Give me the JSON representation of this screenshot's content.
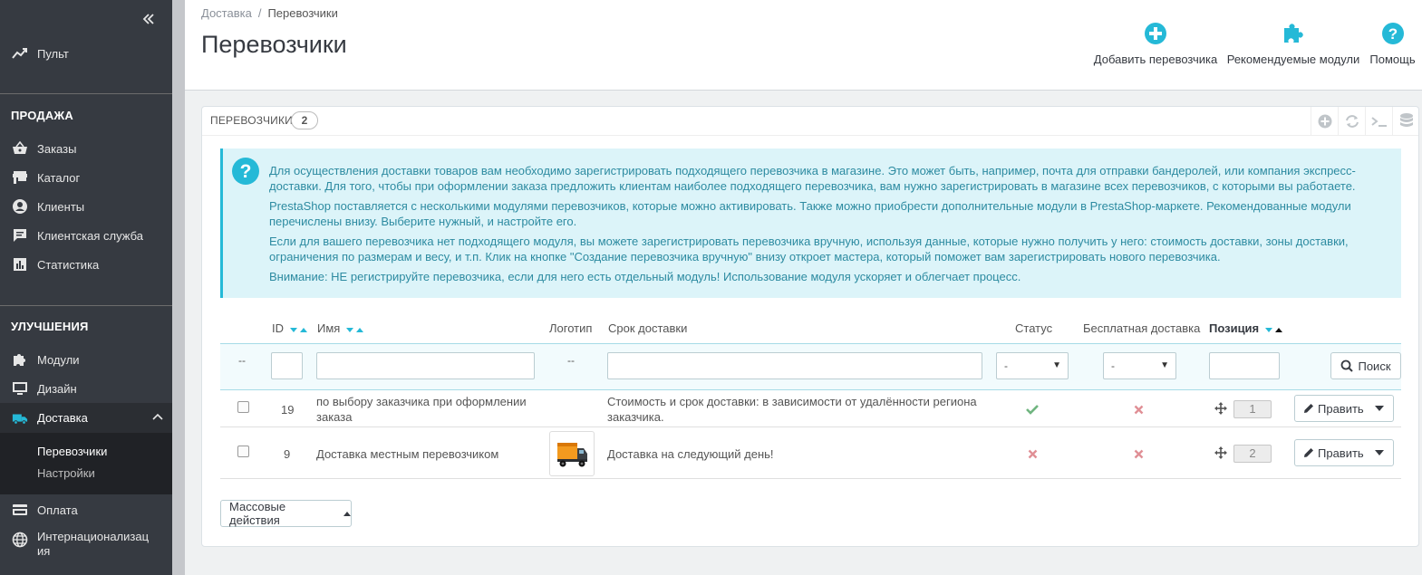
{
  "sidebar": {
    "items_top": [
      {
        "label": "Пульт",
        "icon": "trending-up-icon"
      }
    ],
    "section_sales": "ПРОДАЖА",
    "sales_items": [
      {
        "label": "Заказы",
        "icon": "basket-icon"
      },
      {
        "label": "Каталог",
        "icon": "store-icon"
      },
      {
        "label": "Клиенты",
        "icon": "account-icon"
      },
      {
        "label": "Клиентская служба",
        "icon": "chat-icon"
      },
      {
        "label": "Статистика",
        "icon": "bar-chart-icon"
      }
    ],
    "section_improve": "УЛУЧШЕНИЯ",
    "improve_items": [
      {
        "label": "Модули",
        "icon": "puzzle-icon"
      },
      {
        "label": "Дизайн",
        "icon": "monitor-icon"
      },
      {
        "label": "Доставка",
        "icon": "truck-icon",
        "active": true
      },
      {
        "label": "Оплата",
        "icon": "credit-card-icon"
      },
      {
        "label": "Интернационализация",
        "icon": "globe-icon"
      }
    ],
    "intl_line1": "Интернационализац",
    "intl_line2": "ия",
    "shipping_sub": [
      "Перевозчики",
      "Настройки"
    ]
  },
  "header": {
    "breadcrumb": [
      "Доставка",
      "Перевозчики"
    ],
    "title": "Перевозчики",
    "toolbar": [
      {
        "label": "Добавить перевозчика",
        "icon": "add-circle-icon"
      },
      {
        "label": "Рекомендуемые модули",
        "icon": "puzzle-icon"
      },
      {
        "label": "Помощь",
        "icon": "help-circle-icon"
      }
    ]
  },
  "panel": {
    "title": "Перевозчики",
    "count": "2",
    "info": [
      "Для осуществления доставки товаров вам необходимо зарегистрировать подходящего перевозчика в магазине. Это может быть, например, почта для отправки бандеролей, или компания экспресс-доставки. Для того, чтобы при оформлении заказа предложить клиентам наиболее подходящего перевозчика, вам нужно зарегистрировать в магазине всех перевозчиков, с которыми вы работаете.",
      "PrestaShop поставляется с несколькими модулями перевозчиков, которые можно активировать. Также можно приобрести дополнительные модули в PrestaShop-маркете. Рекомендованные модули перечислены внизу. Выберите нужный, и настройте его.",
      "Если для вашего перевозчика нет подходящего модуля, вы можете зарегистрировать перевозчика вручную, используя данные, которые нужно получить у него: стоимость доставки, зоны доставки, ограничения по размерам и весу, и т.п. Клик на кнопке \"Создание перевозчика вручную\" внизу откроет мастера, который поможет вам зарегистрировать нового перевозчика.",
      "Внимание: НЕ регистрируйте перевозчика, если для него есть отдельный модуль! Использование модуля ускоряет и облегчает процесс."
    ],
    "columns": {
      "id": "ID",
      "name": "Имя",
      "logo": "Логотип",
      "delay": "Срок доставки",
      "status": "Статус",
      "free": "Бесплатная доставка",
      "position": "Позиция"
    },
    "filter": {
      "id_dash": "--",
      "logo_dash": "--",
      "status_value": "-",
      "free_value": "-",
      "search_label": "Поиск"
    },
    "rows": [
      {
        "id": "19",
        "name": "по выбору заказчика при оформлении заказа",
        "name_l1": "по выбору заказчика при оформлении",
        "name_l2": "заказа",
        "delay_l1": "Стоимость и срок доставки: в зависимости от удалённости региона",
        "delay_l2": "заказчика.",
        "status": "enabled",
        "free_shipping": "disabled",
        "position": "1",
        "edit_label": "Править"
      },
      {
        "id": "9",
        "name": "Доставка местным перевозчиком",
        "delay": "Доставка на следующий день!",
        "logo": "truck-logo",
        "status": "disabled",
        "free_shipping": "disabled",
        "position": "2",
        "edit_label": "Править"
      }
    ],
    "bulk_label": "Массовые действия"
  },
  "colors": {
    "accent": "#25b9d7",
    "sidebar_bg": "#363a41",
    "success": "#70b580",
    "danger": "#e08f95"
  }
}
